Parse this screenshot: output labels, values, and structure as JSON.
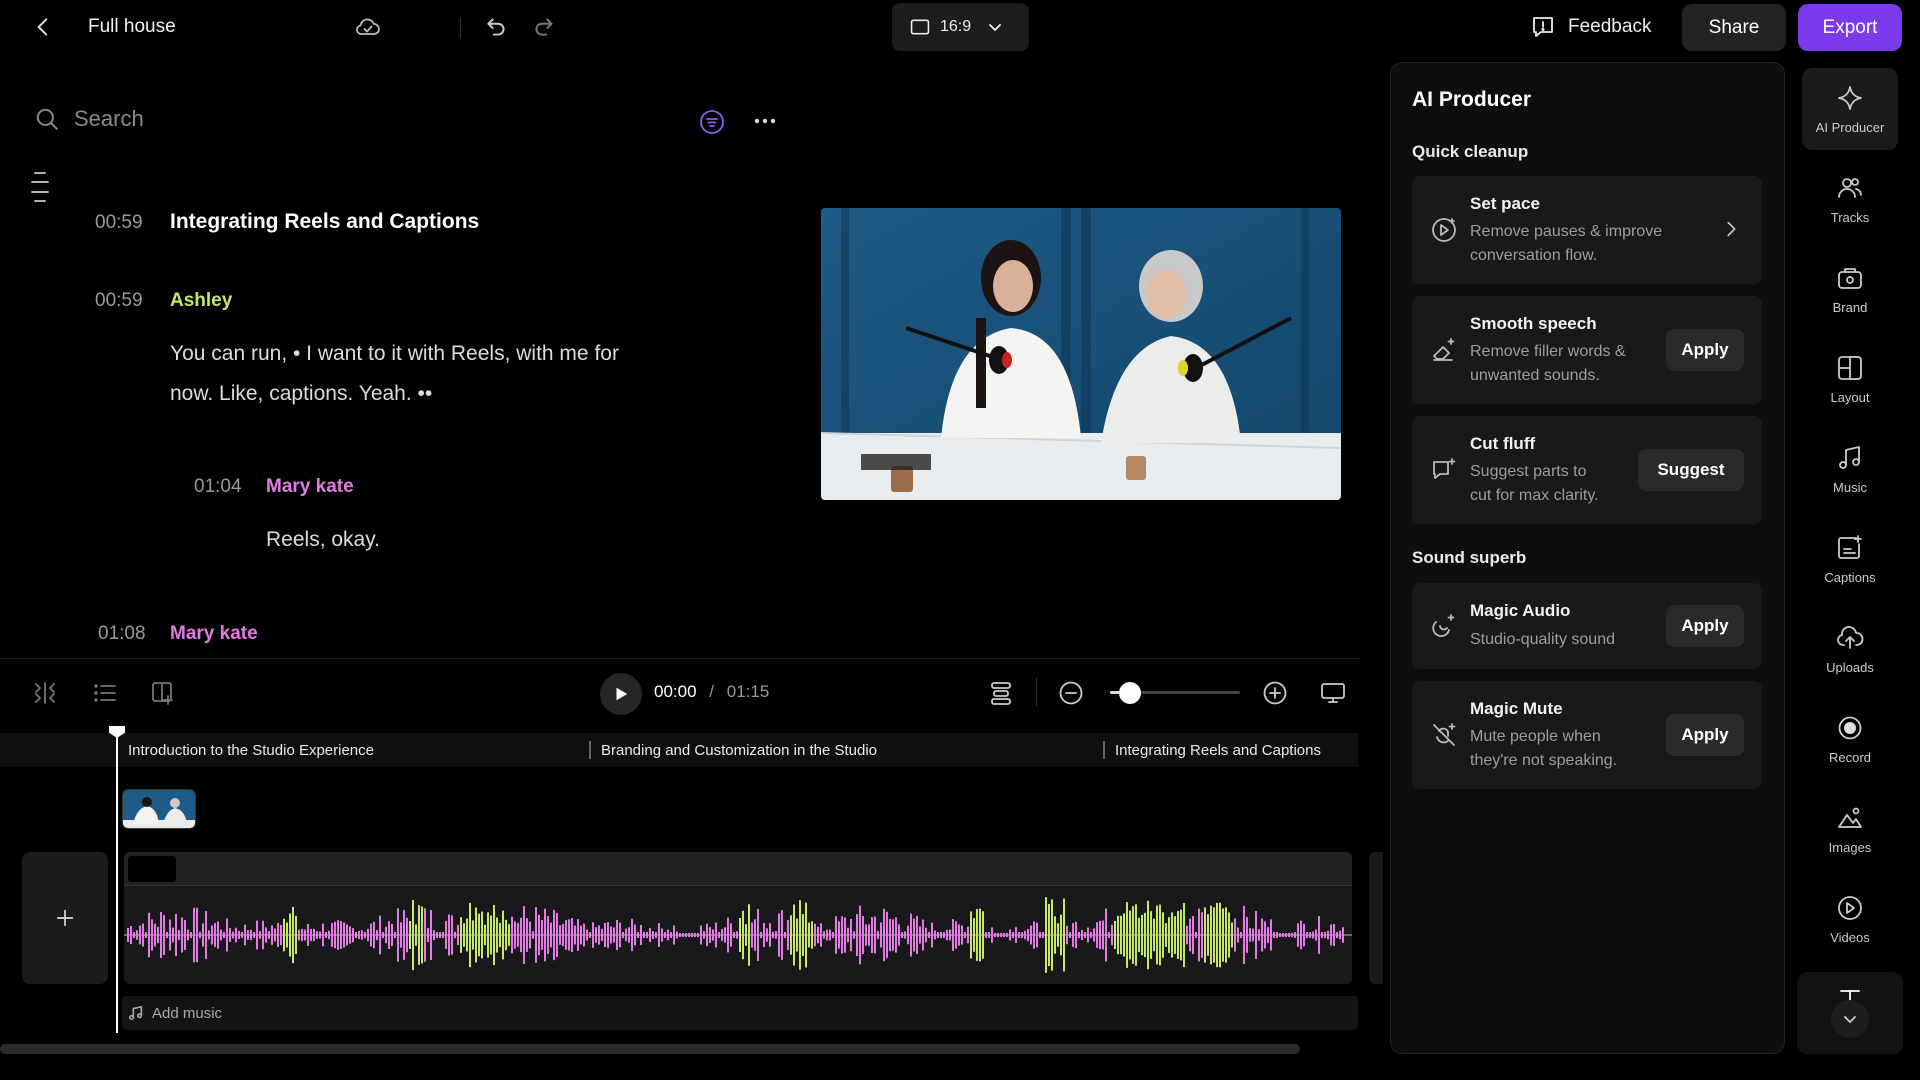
{
  "header": {
    "project_title": "Full house",
    "aspect_ratio": "16:9",
    "feedback_label": "Feedback",
    "share_label": "Share",
    "export_label": "Export",
    "export_color": "#7c3aed"
  },
  "transcript": {
    "search_placeholder": "Search",
    "chapter": {
      "time": "00:59",
      "title": "Integrating Reels and Captions"
    },
    "entries": [
      {
        "time": "00:59",
        "speaker": "Ashley",
        "text_line1": "You can run, • I want to it with Reels, with me for",
        "text_line2": "now. Like, captions. Yeah. ••"
      },
      {
        "time": "01:04",
        "speaker": "Mary kate",
        "text": "Reels, okay."
      },
      {
        "time": "01:08",
        "speaker": "Mary kate"
      }
    ],
    "speaker_colors": {
      "Ashley": "#c4e86b",
      "Mary kate": "#e27be3"
    }
  },
  "playback": {
    "current_time": "00:00",
    "separator": "/",
    "total_time": "01:15",
    "zoom_level": 0.15
  },
  "timeline": {
    "chapters": [
      "Introduction to the Studio Experience",
      "Branding and Customization in the Studio",
      "Integrating Reels and Captions"
    ],
    "add_music_label": "Add music"
  },
  "ai_producer": {
    "title": "AI Producer",
    "sections": [
      {
        "title": "Quick cleanup",
        "cards": [
          {
            "title": "Set pace",
            "desc_line1": "Remove pauses & improve",
            "desc_line2": "conversation flow.",
            "action": ""
          },
          {
            "title": "Smooth speech",
            "desc_line1": "Remove filler words &",
            "desc_line2": "unwanted sounds.",
            "action": "Apply"
          },
          {
            "title": "Cut fluff",
            "desc_line1": "Suggest parts to",
            "desc_line2": "cut for max clarity.",
            "action": "Suggest"
          }
        ]
      },
      {
        "title": "Sound superb",
        "cards": [
          {
            "title": "Magic Audio",
            "desc_line1": "Studio-quality sound",
            "action": "Apply"
          },
          {
            "title": "Magic Mute",
            "desc_line1": "Mute people when",
            "desc_line2": "they're not speaking.",
            "action": "Apply"
          }
        ]
      }
    ]
  },
  "rail": {
    "items": [
      "AI Producer",
      "Tracks",
      "Brand",
      "Layout",
      "Music",
      "Captions",
      "Uploads",
      "Record",
      "Images",
      "Videos"
    ],
    "active": "AI Producer"
  }
}
